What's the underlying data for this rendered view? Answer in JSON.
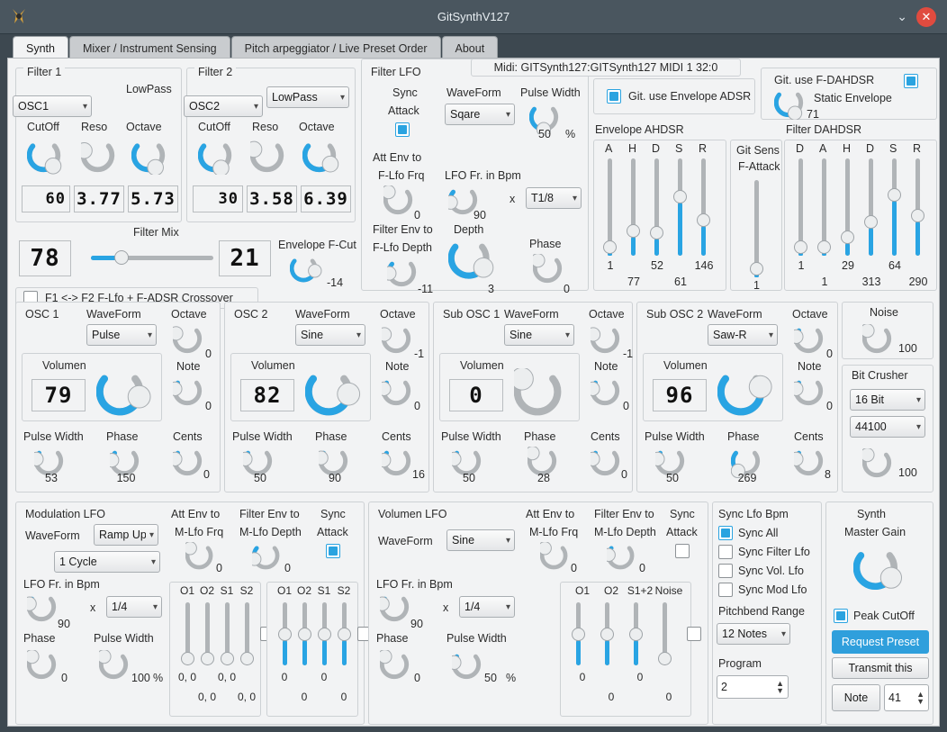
{
  "window": {
    "title": "GitSynthV127",
    "chevron": "⌄",
    "close": "✕"
  },
  "tabs": [
    {
      "label": "Synth",
      "active": true
    },
    {
      "label": "Mixer / Instrument Sensing",
      "active": false
    },
    {
      "label": "Pitch arpeggiator / Live Preset Order",
      "active": false
    },
    {
      "label": "About",
      "active": false
    }
  ],
  "midi": {
    "label": "Midi: GITSynth127:GITSynth127 MIDI 1 32:0"
  },
  "filter1": {
    "title": "Filter 1",
    "source": "OSC1",
    "type": "LowPass",
    "cutoff_label": "CutOff",
    "reso_label": "Reso",
    "octave_label": "Octave",
    "cutoff": "60",
    "reso": "3.77",
    "octave": "5.73",
    "cutoff_pct": 66,
    "reso_pct": 8,
    "octave_pct": 62
  },
  "filter2": {
    "title": "Filter 2",
    "source": "OSC2",
    "type": "LowPass",
    "cutoff_label": "CutOff",
    "reso_label": "Reso",
    "octave_label": "Octave",
    "cutoff": "30",
    "reso": "3.58",
    "octave": "6.39",
    "cutoff_pct": 60,
    "reso_pct": 6,
    "octave_pct": 70
  },
  "filtermix": {
    "label": "Filter Mix",
    "left": "78",
    "right": "21",
    "pct": 22,
    "envfcut_label": "Envelope F-Cut",
    "envfcut": "-14",
    "envfcut_pct": 80,
    "crossover_label": "F1 <-> F2 F-Lfo + F-ADSR Crossover",
    "crossover_on": false
  },
  "filterlfo": {
    "title": "Filter LFO",
    "sync_label": "Sync",
    "attack_label": "Attack",
    "sync_attack_on": true,
    "waveform_label": "WaveForm",
    "waveform": "Sqare",
    "pulsewidth_label": "Pulse Width",
    "pulsewidth": "50",
    "pw_unit": "%",
    "pw_pct": 50,
    "attenv_label1": "Att Env to",
    "attenv_label2": "F-Lfo Frq",
    "attenv": "0",
    "attenv_pct": 0,
    "lfobpm_label": "LFO Fr. in Bpm",
    "lfobpm": "90",
    "lfobpm_pct": 20,
    "mult_label": "x",
    "division": "T1/8",
    "filterenv_label1": "Filter Env to",
    "filterenv_label2": "F-Lfo Depth",
    "filterenv": "-11",
    "filterenv_pct": 18,
    "depth_label": "Depth",
    "depth": "3",
    "depth_pct": 72,
    "phase_label": "Phase",
    "phase": "0",
    "phase_pct": 0
  },
  "envadsr_toggle": {
    "label": "Git. use Envelope ADSR",
    "on": true
  },
  "fdahdsr": {
    "label": "Git. use F-DAHDSR",
    "on": true,
    "static_label": "Static Envelope",
    "static_value": "71",
    "static_pct": 62
  },
  "env_ahdsr": {
    "title": "Envelope AHDSR",
    "stages": [
      {
        "name": "A",
        "value": "1",
        "pct": 2,
        "row": 0
      },
      {
        "name": "H",
        "value": "77",
        "pct": 22,
        "row": 1
      },
      {
        "name": "D",
        "value": "52",
        "pct": 19,
        "row": 0
      },
      {
        "name": "S",
        "value": "61",
        "pct": 62,
        "row": 1
      },
      {
        "name": "R",
        "value": "146",
        "pct": 34,
        "row": 0
      }
    ]
  },
  "gitsens": {
    "label1": "Git Sens",
    "label2": "F-Attack",
    "value": "1",
    "pct": 2
  },
  "filter_dahdsr": {
    "title": "Filter DAHDSR",
    "stages": [
      {
        "name": "D",
        "value": "1",
        "pct": 2,
        "row": 0
      },
      {
        "name": "A",
        "value": "1",
        "pct": 2,
        "row": 1
      },
      {
        "name": "H",
        "value": "29",
        "pct": 14,
        "row": 0
      },
      {
        "name": "D",
        "value": "313",
        "pct": 32,
        "row": 1
      },
      {
        "name": "S",
        "value": "64",
        "pct": 64,
        "row": 0
      },
      {
        "name": "R",
        "value": "290",
        "pct": 40,
        "row": 1
      }
    ]
  },
  "oscillators": [
    {
      "title": "OSC 1",
      "waveform_label": "WaveForm",
      "waveform": "Pulse",
      "octave_label": "Octave",
      "octave": "0",
      "octave_pct": 6,
      "volumen_label": "Volumen",
      "volumen": "79",
      "volumen_pct": 79,
      "note_label": "Note",
      "note": "0",
      "note_pct": 12,
      "pw_label": "Pulse Width",
      "pw": "53",
      "pw_pct": 12,
      "phase_label": "Phase",
      "phase": "150",
      "phase_pct": 14,
      "cents_label": "Cents",
      "cents": "0",
      "cents_pct": 12
    },
    {
      "title": "OSC 2",
      "waveform_label": "WaveForm",
      "waveform": "Sine",
      "octave_label": "Octave",
      "octave": "-1",
      "octave_pct": 8,
      "volumen_label": "Volumen",
      "volumen": "82",
      "volumen_pct": 82,
      "note_label": "Note",
      "note": "0",
      "note_pct": 12,
      "pw_label": "Pulse Width",
      "pw": "50",
      "pw_pct": 12,
      "phase_label": "Phase",
      "phase": "90",
      "phase_pct": 10,
      "cents_label": "Cents",
      "cents": "16",
      "cents_pct": 14
    },
    {
      "title": "Sub OSC 1",
      "waveform_label": "WaveForm",
      "waveform": "Sine",
      "octave_label": "Octave",
      "octave": "-1",
      "octave_pct": 8,
      "volumen_label": "Volumen",
      "volumen": "0",
      "volumen_pct": 0,
      "note_label": "Note",
      "note": "0",
      "note_pct": 12,
      "pw_label": "Pulse Width",
      "pw": "50",
      "pw_pct": 12,
      "phase_label": "Phase",
      "phase": "28",
      "phase_pct": 0,
      "cents_label": "Cents",
      "cents": "0",
      "cents_pct": 12
    },
    {
      "title": "Sub OSC 2",
      "waveform_label": "WaveForm",
      "waveform": "Saw-R",
      "octave_label": "Octave",
      "octave": "0",
      "octave_pct": 12,
      "volumen_label": "Volumen",
      "volumen": "96",
      "volumen_pct": 90,
      "note_label": "Note",
      "note": "0",
      "note_pct": 12,
      "pw_label": "Pulse Width",
      "pw": "50",
      "pw_pct": 12,
      "phase_label": "Phase",
      "phase": "269",
      "phase_pct": 36,
      "cents_label": "Cents",
      "cents": "8",
      "cents_pct": 12
    }
  ],
  "noise": {
    "title": "Noise",
    "value": "100",
    "pct": 0
  },
  "bitcrusher": {
    "title": "Bit Crusher",
    "bits": "16 Bit",
    "rate": "44100",
    "value": "100",
    "pct": 0
  },
  "modlfo": {
    "title": "Modulation LFO",
    "waveform_label": "WaveForm",
    "waveform": "Ramp Up",
    "cycle": "1 Cycle",
    "lfobpm_label": "LFO Fr. in Bpm",
    "lfobpm": "90",
    "lfobpm_pct": 10,
    "mult_label": "x",
    "division": "1/4",
    "phase_label": "Phase",
    "phase": "0",
    "phase_pct": 0,
    "pw_label": "Pulse Width",
    "pw": "100",
    "pw_unit": "%",
    "pw_pct": 0,
    "attenv_label1": "Att Env to",
    "attenv_label2": "M-Lfo Frq",
    "attenv": "0",
    "attenv_pct": 0,
    "filterenv_label1": "Filter Env to",
    "filterenv_label2": "M-Lfo Depth",
    "filterenv": "0",
    "filterenv_pct": 22,
    "sync_label": "Sync",
    "attack_label": "Attack",
    "sync_attack_on": true,
    "group_a": {
      "headers": [
        "O1",
        "O2",
        "S1",
        "S2"
      ],
      "values": [
        "0, 0",
        "0, 0",
        "0, 0",
        "0, 0"
      ],
      "pcts": [
        0,
        0,
        0,
        0
      ],
      "extra_on": false
    },
    "group_b": {
      "headers": [
        "O1",
        "O2",
        "S1",
        "S2"
      ],
      "values": [
        "0",
        "0",
        "0",
        "0"
      ],
      "pcts": [
        50,
        50,
        50,
        50
      ],
      "extra_on": false
    }
  },
  "vollfo": {
    "title": "Volumen LFO",
    "waveform_label": "WaveForm",
    "waveform": "Sine",
    "lfobpm_label": "LFO Fr. in Bpm",
    "lfobpm": "90",
    "lfobpm_pct": 10,
    "mult_label": "x",
    "division": "1/4",
    "phase_label": "Phase",
    "phase": "0",
    "phase_pct": 0,
    "pw_label": "Pulse Width",
    "pw": "50",
    "pw_unit": "%",
    "pw_pct": 12,
    "attenv_label1": "Att Env to",
    "attenv_label2": "M-Lfo Frq",
    "attenv": "0",
    "attenv_pct": 0,
    "filterenv_label1": "Filter Env to",
    "filterenv_label2": "M-Lfo Depth",
    "filterenv": "0",
    "filterenv_pct": 14,
    "sync_label": "Sync",
    "attack_label": "Attack",
    "sync_attack_on": false,
    "group": {
      "headers": [
        "O1",
        "O2",
        "S1+2",
        "Noise"
      ],
      "values": [
        "0",
        "0",
        "0",
        "0"
      ],
      "pcts": [
        50,
        50,
        50,
        0
      ],
      "extra_on": false
    }
  },
  "sync": {
    "title": "Sync Lfo Bpm",
    "items": [
      {
        "label": "Sync All",
        "on": true
      },
      {
        "label": "Sync Filter Lfo",
        "on": false
      },
      {
        "label": "Sync Vol. Lfo",
        "on": false
      },
      {
        "label": "Sync Mod Lfo",
        "on": false
      }
    ],
    "pitchbend_label": "Pitchbend Range",
    "pitchbend": "12 Notes",
    "program_label": "Program",
    "program": "2"
  },
  "master": {
    "title1": "Synth",
    "title2": "Master Gain",
    "gain_pct": 72,
    "peak_label": "Peak CutOff",
    "peak_on": true,
    "request_label": "Request Preset",
    "transmit_label": "Transmit this",
    "note_label": "Note",
    "note_value": "41"
  },
  "colors": {
    "accent": "#29a4e3",
    "track": "#b0b4b7",
    "panel": "#f2f3f4"
  }
}
